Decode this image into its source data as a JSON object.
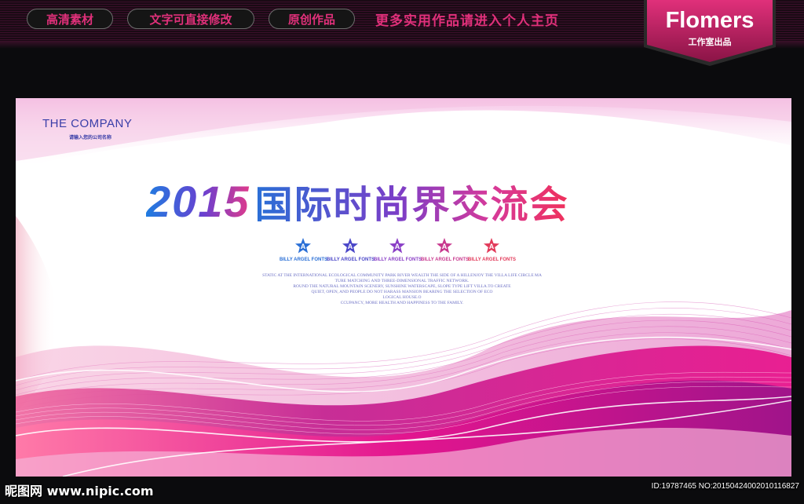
{
  "top_bar": {
    "pills": [
      "高清素材",
      "文字可直接修改",
      "原创作品"
    ],
    "promo": "更多实用作品请进入个人主页"
  },
  "brand": {
    "name": "Flomers",
    "sub": "工作室出品"
  },
  "poster": {
    "company_name": "THE COMPANY",
    "company_sub": "请输入您的公司名称",
    "title_year": "2015",
    "title_cn": "国际时尚界交流会",
    "star_letter": "A",
    "star_labels": [
      "BILLY ARGEL FONTS",
      "BILLY ARGEL FONTS",
      "BILLY ARGEL FONTS",
      "BILLY ARGEL FONTS",
      "BILLY ARGEL FONTS"
    ],
    "body_lines": [
      "STATIC AT THE INTERNATIONAL ECOLOGICAL COMMUNITY PARK RIVER WEALTH THE SIDE OF A HILLENJOY THE VILLA LIFE CIRCLE MA",
      "TURE MATCHING AND THREE-DIMENSIONAL TRAFFIC NETWORK.",
      "ROUND THE NATURAL MOUNTAIN SCENERY, SUNSHINE WATERSCAPE, SLOPE TYPE LIFT VILLA.TO CREATE",
      "QUIET, OPEN, AND PEOPLE DO NOT HARASS MANSION BEARING THE SELECTION OF ECO",
      "LOGICAL HOUSE.O",
      "CCUPANCY, MORE HEALTH AND HAPPINESS TO THE FAMILY."
    ]
  },
  "watermarks": {
    "left": "昵图网 www.nipic.com",
    "right": "ID:19787465 NO:20150424002010116827"
  },
  "colors": {
    "accent_pink": "#e0307a",
    "company_blue": "#3a3ea8",
    "star_colors": [
      "#2a6fd6",
      "#4a46c8",
      "#8a3ec6",
      "#c8388e",
      "#e23a5a"
    ]
  }
}
